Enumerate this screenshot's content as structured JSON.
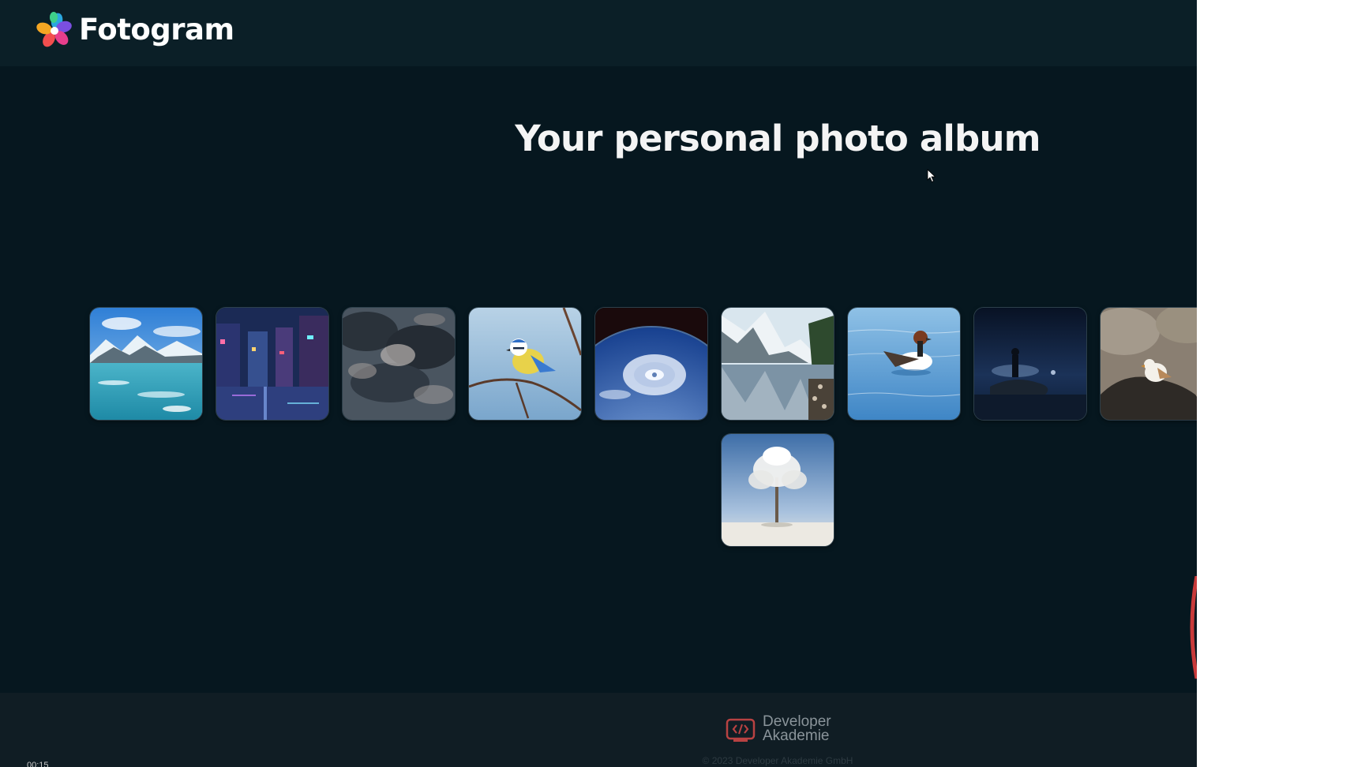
{
  "header": {
    "brand": "Fotogram",
    "logo_icon": "flower-petals-logo"
  },
  "main": {
    "title": "Your personal photo album"
  },
  "gallery": {
    "photos": [
      {
        "subject": "glacier lake with snowy mountains"
      },
      {
        "subject": "neon city street at night"
      },
      {
        "subject": "dark storm clouds"
      },
      {
        "subject": "blue tit bird on branch"
      },
      {
        "subject": "hurricane seen from space"
      },
      {
        "subject": "mountain lake with snowy peaks"
      },
      {
        "subject": "duck on blue water"
      },
      {
        "subject": "person standing on rock at night"
      },
      {
        "subject": "snow bunting bird on rocks"
      },
      {
        "subject": "frosted tree in snowy field"
      }
    ]
  },
  "footer": {
    "brand_line1": "Developer",
    "brand_line2": "Akademie",
    "copyright": "© 2023 Developer Akademie GmbH",
    "logo_icon": "code-brackets-logo"
  },
  "overlay": {
    "time": "00:15"
  },
  "colors": {
    "background": "#06171f",
    "header": "#0b1f27",
    "footer": "#101d24",
    "title_text": "#f4f4f4"
  }
}
